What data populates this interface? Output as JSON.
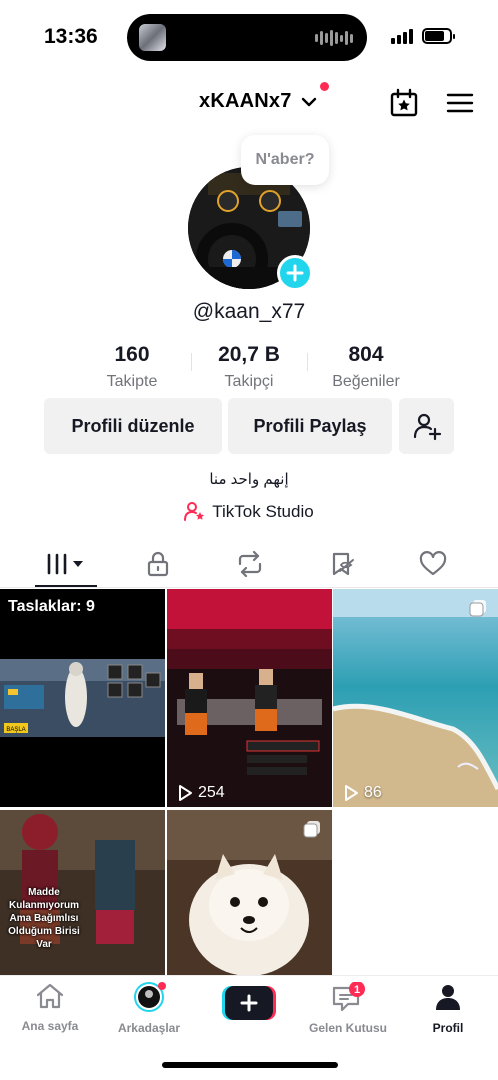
{
  "status_bar": {
    "time": "13:36",
    "battery_level_fraction": 0.8,
    "signal_bars": 4
  },
  "header": {
    "username": "xKAANx7",
    "has_notification_dot": true
  },
  "profile": {
    "note": "N'aber?",
    "handle": "@kaan_x77",
    "stats": [
      {
        "value": "160",
        "label": "Takipte"
      },
      {
        "value": "20,7 B",
        "label": "Takipçi"
      },
      {
        "value": "804",
        "label": "Beğeniler"
      }
    ],
    "buttons": {
      "edit": "Profili düzenle",
      "share": "Profili Paylaş"
    },
    "bio": "إنهم واحد منا",
    "studio_link": "TikTok Studio"
  },
  "tabs": [
    {
      "name": "videos",
      "icon": "grid-icon",
      "active": true
    },
    {
      "name": "private",
      "icon": "lock-icon",
      "active": false
    },
    {
      "name": "reposts",
      "icon": "repost-icon",
      "active": false
    },
    {
      "name": "favorites",
      "icon": "bookmark-hidden-icon",
      "active": false
    },
    {
      "name": "liked",
      "icon": "heart-icon",
      "active": false
    }
  ],
  "grid": {
    "drafts_label": "Taslaklar: 9",
    "items": [
      {
        "kind": "drafts",
        "overlay_text": ""
      },
      {
        "kind": "video",
        "views": "254"
      },
      {
        "kind": "photo",
        "views": "86"
      },
      {
        "kind": "video",
        "overlay_text": "Madde Kulanmıyorum Ama Bağımlısı Olduğum Birisi Var"
      },
      {
        "kind": "photo"
      }
    ]
  },
  "game_overlay": {
    "button": "BAŞLA"
  },
  "bottom_nav": {
    "items": [
      {
        "label": "Ana sayfa",
        "icon": "home-icon",
        "active": false
      },
      {
        "label": "Arkadaşlar",
        "icon": "friends-avatar-icon",
        "active": false
      },
      {
        "label": "",
        "icon": "create-plus-icon",
        "active": false
      },
      {
        "label": "Gelen Kutusu",
        "icon": "inbox-icon",
        "active": false,
        "badge": "1"
      },
      {
        "label": "Profil",
        "icon": "profile-icon",
        "active": true
      }
    ]
  },
  "colors": {
    "accent": "#fe2c55",
    "cyan": "#20d5ec",
    "text": "#161823",
    "muted": "#73747b"
  }
}
